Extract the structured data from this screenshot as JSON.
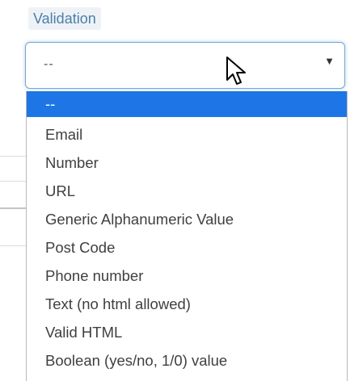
{
  "field": {
    "label": "Validation"
  },
  "select": {
    "value": "--",
    "arrow": "▼",
    "icon": "chevron-down-icon"
  },
  "dropdown": {
    "options": [
      {
        "label": "--",
        "selected": true
      },
      {
        "label": "Email"
      },
      {
        "label": "Number"
      },
      {
        "label": "URL"
      },
      {
        "label": "Generic Alphanumeric Value"
      },
      {
        "label": "Post Code"
      },
      {
        "label": "Phone number"
      },
      {
        "label": "Text (no html allowed)"
      },
      {
        "label": "Valid HTML"
      },
      {
        "label": "Boolean (yes/no, 1/0) value"
      }
    ]
  },
  "colors": {
    "label_text": "#4a7faa",
    "label_background": "#eef2f6",
    "select_border": "#7aa6cf",
    "selected_option_background": "#1e76e6",
    "selected_option_text": "#ffffff",
    "option_text": "#3f3f3f"
  }
}
